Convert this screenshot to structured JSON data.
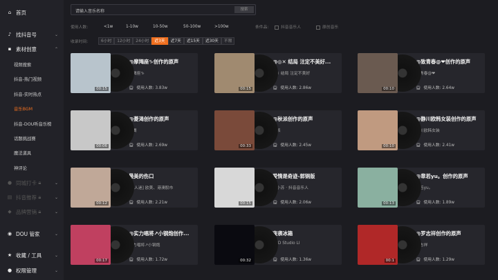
{
  "sidebar": {
    "home": "首页",
    "find": "找抖音号",
    "material": "素材创意",
    "subs": [
      "视频搜索",
      "抖音-热门视频",
      "抖音-实时热点",
      "音乐BGM",
      "抖音-DOU听音乐榜",
      "话题挑战赛",
      "魔法道具",
      "神评论"
    ],
    "locked": [
      "同城打卡",
      "抖音推荐",
      "品牌营销"
    ],
    "dou": "DOU 管家",
    "fav": "收藏 / 工具",
    "perm": "权限管理"
  },
  "search": {
    "placeholder": "请输入音乐名称",
    "button": "搜索"
  },
  "filters": {
    "users_label": "使用人数:",
    "users_options": [
      "<1w",
      "1-10w",
      "10-50w",
      "50-100w",
      ">100w"
    ],
    "cond_label": "条件品:",
    "checks": [
      "抖音音乐人",
      "原创音乐"
    ],
    "time_label": "收录时间:",
    "time_options": [
      "6小时",
      "12小时",
      "24小时",
      "近3天",
      "近7天",
      "近15天",
      "近30天",
      "不限"
    ],
    "time_active": "近3天"
  },
  "use_label": "使用人数:",
  "cards": [
    {
      "title": "@摩羯座♑创作的原声",
      "author": "摩羯座♑",
      "count": "3.83w",
      "dur": "00:15",
      "c": "#b8c4cc"
    },
    {
      "title": "@◎✕ 结局 注定不美好...",
      "author": "◎✕ 结局 注定不美好",
      "count": "2.86w",
      "dur": "00:15",
      "c": "#a08a70"
    },
    {
      "title": "@致青春@❤创作的原声",
      "author": "致青春@❤",
      "count": "2.64w",
      "dur": "00:10",
      "c": "#6a5a50"
    },
    {
      "title": "@菱渴创作的原声",
      "author": "菱渴",
      "count": "2.69w",
      "dur": "00:06",
      "c": "#c8c8c8"
    },
    {
      "title": "@秋派创作的原声",
      "author": "秋派",
      "count": "2.45w",
      "dur": "00:33",
      "c": "#7a4a3a"
    },
    {
      "title": "@静川欧韩女装创作的原声",
      "author": "静川欧韩女装",
      "count": "2.41w",
      "dur": "00:10",
      "c": "#c09a80"
    },
    {
      "title": "最美的伤口",
      "author": "[万人迷] 欧美、港澳股市",
      "count": "2.21w",
      "dur": "00:12",
      "c": "#c0a898"
    },
    {
      "title": "爱情是奇迹-郭铜版",
      "author": "曹小苏 · 抖音音乐人",
      "count": "2.06w",
      "dur": "00:15",
      "c": "#d8d8d8"
    },
    {
      "title": "@章若yu。创作的原声",
      "author": "章若yu。",
      "count": "1.89w",
      "dur": "00:13",
      "c": "#8ab0a0"
    },
    {
      "title": "@实力唱将↗小钢炮创作...",
      "author": "实力唱将↗小钢炮",
      "count": "1.72w",
      "dur": "00:17",
      "c": "#c04060"
    },
    {
      "title": "夜袭冰箱",
      "author": "BCD Studio LI",
      "count": "1.36w",
      "dur": "00:32",
      "c": "#0a0a10"
    },
    {
      "title": "@罗志祥创作的原声",
      "author": "罗志祥",
      "count": "1.29w",
      "dur": "00:1",
      "c": "#b02828"
    }
  ]
}
